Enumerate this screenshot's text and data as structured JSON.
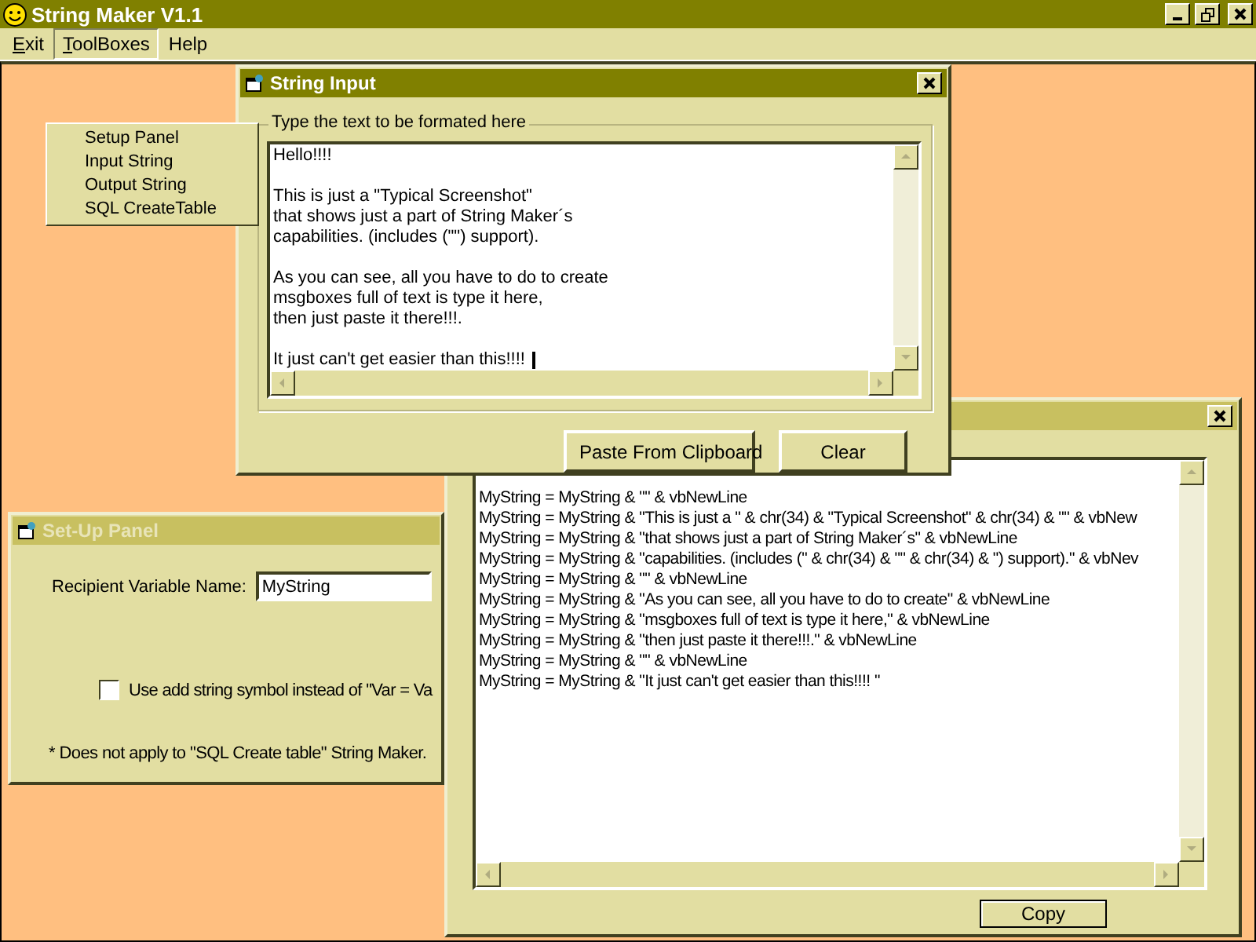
{
  "window": {
    "title": "String Maker V1.1"
  },
  "menu": [
    {
      "label": "Exit",
      "access_key_shown": true,
      "expanded": false
    },
    {
      "label": "ToolBoxes",
      "access_key_shown": true,
      "expanded": true
    },
    {
      "label": "Help",
      "access_key_shown": false,
      "expanded": false
    }
  ],
  "dropdown": [
    "Setup Panel",
    "Input String",
    "Output String",
    "SQL CreateTable"
  ],
  "setup_panel": {
    "title": "Set-Up Panel",
    "active": false,
    "recipient_label": "Recipient Variable Name:",
    "recipient_value": "MyString",
    "option": {
      "label": "Use add string symbol instead of \"Var = Va",
      "checked": false
    },
    "note": "* Does not apply to \"SQL Create table\" String Maker."
  },
  "output_window": {
    "active": false,
    "lines": [
      "MyString = MyString & \"\" & vbNewLine",
      "MyString = MyString & \"This is just a \" & chr(34) & \"Typical Screenshot\" & chr(34) & \"\" & vbNew",
      "MyString = MyString & \"that shows just a part of String Maker´s\" & vbNewLine",
      "MyString = MyString & \"capabilities. (includes (\" & chr(34) & \"\" & chr(34) & \") support).\" & vbNev",
      "MyString = MyString & \"\" & vbNewLine",
      "MyString = MyString & \"As you can see, all you have to do to create\" & vbNewLine",
      "MyString = MyString & \"msgboxes full of text is type it here,\" & vbNewLine",
      "MyString = MyString & \"then just paste it there!!!.\" & vbNewLine",
      "MyString = MyString & \"\" & vbNewLine",
      "MyString = MyString & \"It just can't get easier than this!!!! \""
    ],
    "button": "Copy"
  },
  "input_window": {
    "title": "String Input",
    "active": true,
    "group_label": "Type the text to be formated here",
    "paragraphs": [
      [
        "Hello!!!!"
      ],
      [
        "This is just a \"Typical Screenshot\"",
        "that shows just a part of String Maker´s",
        "capabilities. (includes (\"\") support)."
      ],
      [
        "As you can see, all you have to do to create",
        "msgboxes full of text is type it here,",
        "then just paste it there!!!."
      ],
      [
        "It just can't get easier than this!!!! "
      ]
    ],
    "buttons": [
      "Paste From Clipboard",
      "Clear"
    ]
  }
}
